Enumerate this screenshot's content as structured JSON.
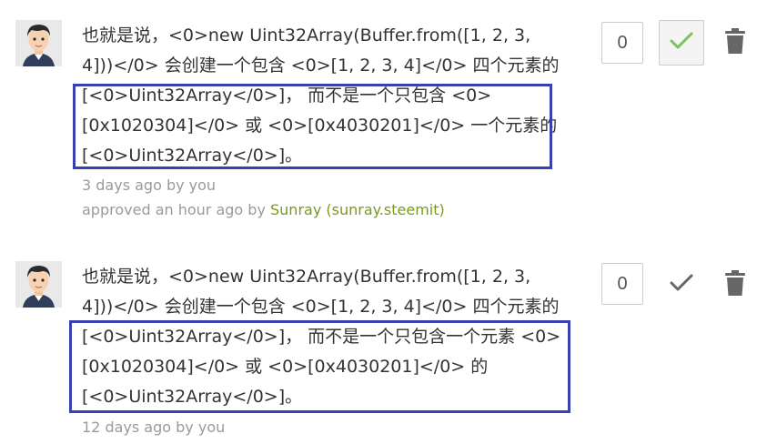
{
  "suggestions": [
    {
      "lines": [
        "也就是说，<0>new Uint32Array(Buffer.from([1, 2, 3,",
        "4]))</0> 会创建一个包含 <0>[1, 2, 3, 4]</0> 四个元素的",
        "[<0>Uint32Array</0>]， 而不是一个只包含 <0>",
        "[0x1020304]</0> 或 <0>[0x4030201]</0> 一个元素的",
        "[<0>Uint32Array</0>]。"
      ],
      "time_text": "3 days ago by you",
      "approved_prefix": "approved an hour ago by ",
      "approver": "Sunray (sunray.steemit)",
      "votes": "0",
      "approved": true
    },
    {
      "lines": [
        "也就是说，<0>new Uint32Array(Buffer.from([1, 2, 3,",
        "4]))</0> 会创建一个包含 <0>[1, 2, 3, 4]</0> 四个元素的",
        "[<0>Uint32Array</0>]， 而不是一个只包含一个元素 <0>",
        "[0x1020304]</0> 或 <0>[0x4030201]</0> 的",
        "[<0>Uint32Array</0>]。"
      ],
      "time_text": "12 days ago by you",
      "votes": "0",
      "approved": false
    }
  ],
  "colors": {
    "highlight_border": "#3b3fb0",
    "approve_active": "#7cc25a",
    "approve_inactive": "#666666",
    "approver_link": "#7a9a1a",
    "meta_text": "#9a9a9a"
  },
  "icons": {
    "avatar": "cartoon-man-avatar",
    "approve": "checkmark-icon",
    "delete": "trash-icon"
  }
}
